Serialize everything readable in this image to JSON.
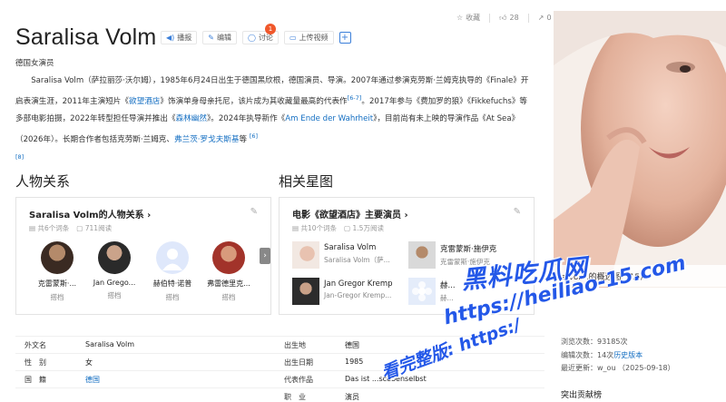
{
  "top_actions": {
    "favorite": "收藏",
    "like_count": "28",
    "share_count": "0"
  },
  "title": "Saralisa Volm",
  "title_actions": {
    "play": "播报",
    "edit": "编辑",
    "discuss": "讨论",
    "discuss_badge": "1",
    "upload": "上传视频"
  },
  "subtitle": "德国女演员",
  "summary": {
    "p1": "Saralisa Volm（萨拉丽莎·沃尔姆），1985年6月24日出生于德国黑欣根，德国演员、导演。2007年通过参演克劳斯·兰姆克执导的《Finale》开启表演生涯，2011年主演短片《",
    "link1": "欲望酒店",
    "p2": "》饰演单身母亲托尼，该片成为其收藏量最高的代表作",
    "ref1": "[6-7]",
    "p3": "。2017年参与《费加罗的狼》《Fikkefuchs》等多部电影拍摄，2022年转型担任导演并推出《",
    "link2": "森林幽然",
    "p4": "》。2024年执导新作《",
    "link3": "Am Ende der Wahrheit",
    "p5": "》，目前尚有未上映的导演作品《At Sea》（2026年）。长期合作者包括克劳斯·兰姆克、",
    "link4": "弗兰茨·罗戈夫斯基",
    "p6": "等",
    "ref2": "[6]",
    "ref3": "[8]"
  },
  "relations": {
    "heading": "人物关系",
    "card_title": "Saralisa Volm的人物关系",
    "entries": "共6个词条",
    "reads": "711阅读",
    "people": [
      {
        "name": "克雷蒙斯·...",
        "role": "搭档"
      },
      {
        "name": "Jan Grego...",
        "role": "搭档"
      },
      {
        "name": "赫伯特·诺普",
        "role": "搭档"
      },
      {
        "name": "弗雷德里克...",
        "role": "搭档"
      }
    ]
  },
  "stars": {
    "heading": "相关星图",
    "card_title": "电影《欲望酒店》主要演员",
    "entries": "共10个词条",
    "reads": "1.5万阅读",
    "actors": [
      {
        "name": "Saralisa Volm",
        "role": "Saralisa Volm（萨..."
      },
      {
        "name": "克雷蒙斯·施伊克",
        "role": "克雷蒙斯·施伊克"
      },
      {
        "name": "Jan Gregor Kremp",
        "role": "Jan-Gregor Kremp..."
      },
      {
        "name": "赫...",
        "role": "赫..."
      }
    ]
  },
  "info": {
    "left": [
      {
        "label": "外文名",
        "value": "Saralisa Volm"
      },
      {
        "label": "性　别",
        "value": "女"
      },
      {
        "label": "国　籍",
        "value": "德国"
      }
    ],
    "right": [
      {
        "label": "出生地",
        "value": "德国"
      },
      {
        "label": "出生日期",
        "value": "1985"
      },
      {
        "label": "代表作品",
        "value": "Das ist ...scebenselbst"
      },
      {
        "label": "职　业",
        "value": "演员"
      }
    ]
  },
  "photo_caption": "a Volm的概述图（15）",
  "stats": {
    "views_label": "浏览次数：",
    "views": "93185次",
    "edits_label": "编辑次数：",
    "edits": "14次",
    "history": "历史版本",
    "updated_label": "最近更新：",
    "updated": "w_ou （2025-09-18）"
  },
  "contrib": "突出贡献榜",
  "watermark": {
    "line1": "黑料吃瓜网",
    "line2": "https://heiliao-15.com",
    "line3": "看完整版: https:/"
  },
  "colors": {
    "link": "#136ec2",
    "badge": "#f0582b",
    "watermark": "#2458e8"
  }
}
